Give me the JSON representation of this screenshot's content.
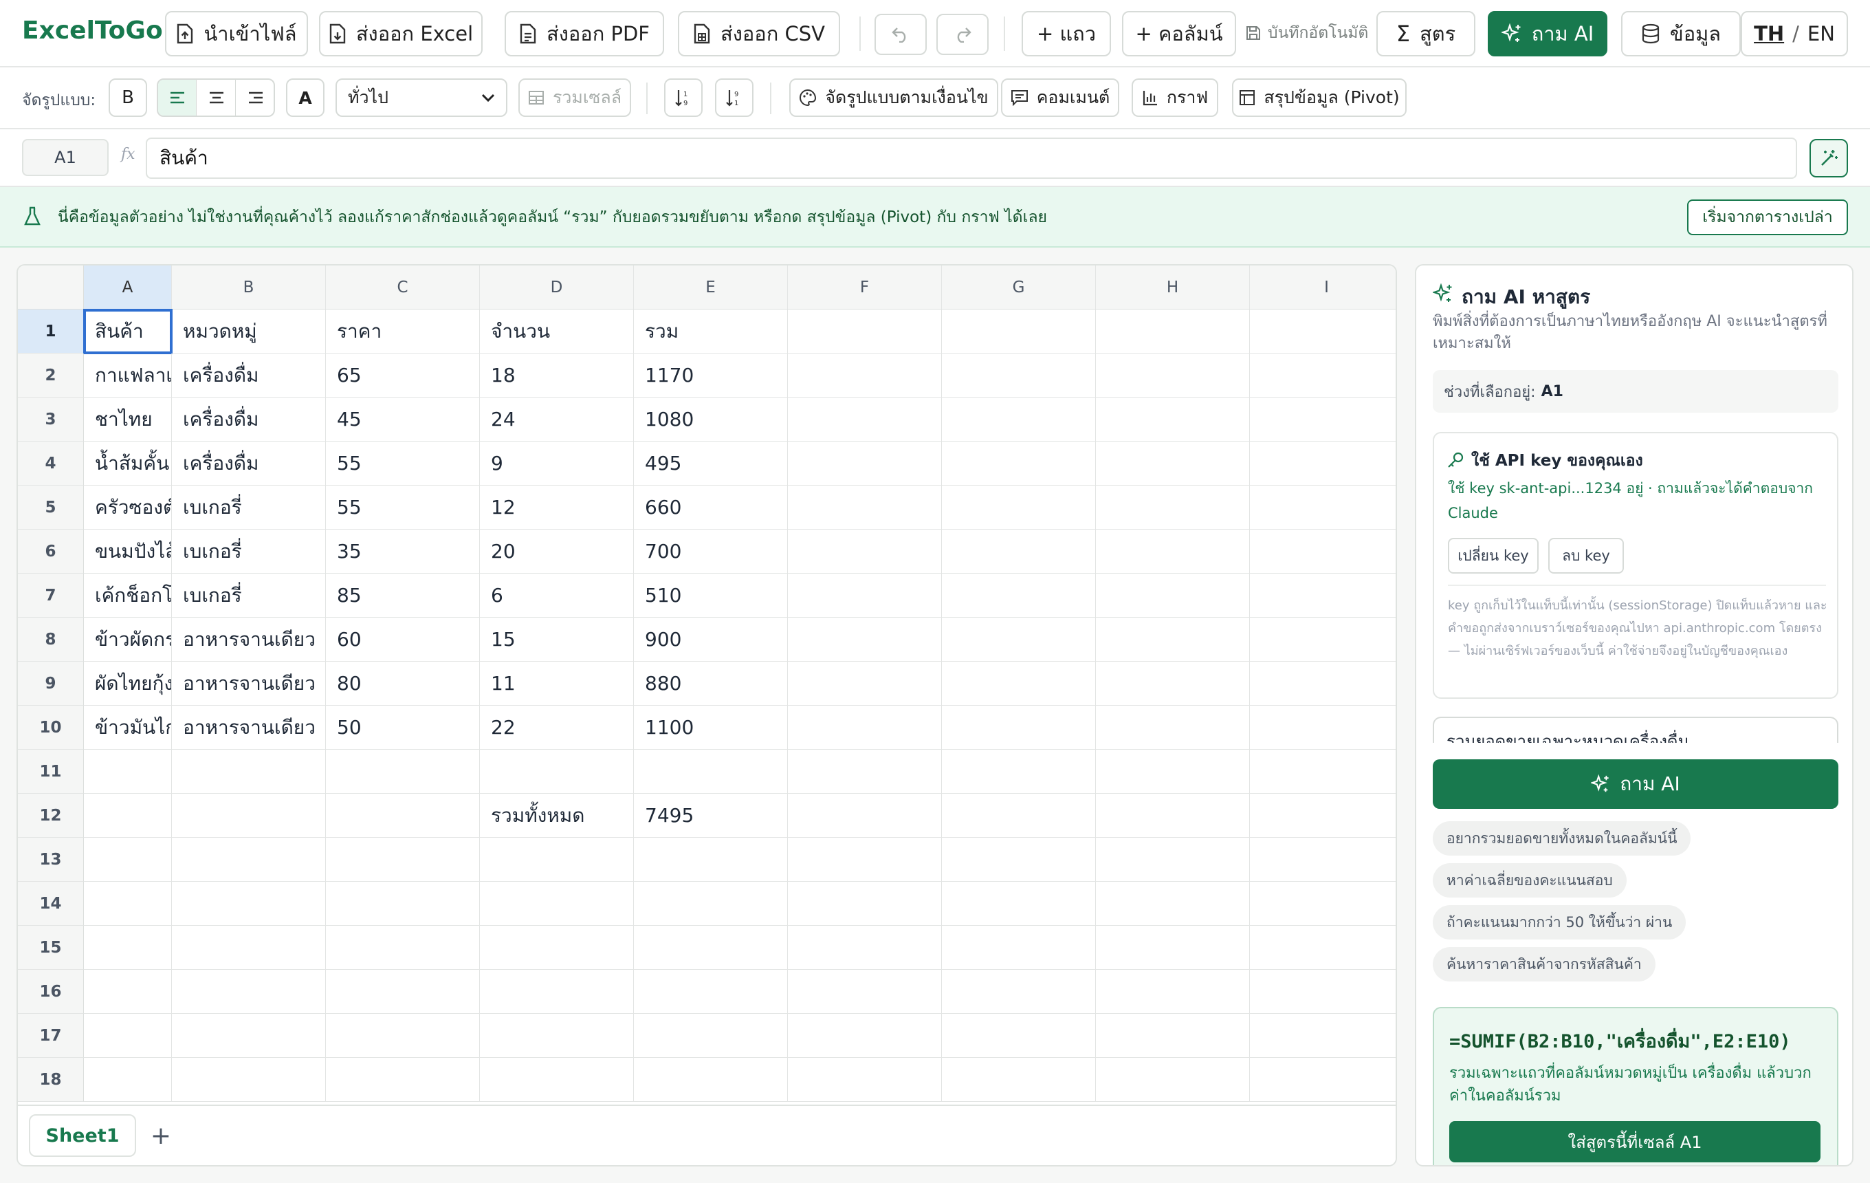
{
  "app": {
    "brand": "ExcelToGo"
  },
  "toolbar": {
    "import": "นำเข้าไฟล์",
    "export_excel": "ส่งออก Excel",
    "export_pdf": "ส่งออก PDF",
    "export_csv": "ส่งออก CSV",
    "add_row": "+ แถว",
    "add_col": "+ คอลัมน์",
    "autosave": "บันทึกอัตโนมัติ",
    "formula": "สูตร",
    "ask_ai": "ถาม AI",
    "data": "ข้อมูล",
    "lang_th": "TH",
    "lang_sep": "/",
    "lang_en": "EN"
  },
  "format_bar": {
    "label": "จัดรูปแบบ:",
    "bold": "B",
    "font_color": "A",
    "number_format": "ทั่วไป",
    "merge": "รวมเซลล์",
    "cond_format": "จัดรูปแบบตามเงื่อนไข",
    "comment": "คอมเมนต์",
    "chart": "กราฟ",
    "pivot": "สรุปข้อมูล (Pivot)"
  },
  "formula_bar": {
    "cell_ref": "A1",
    "fx": "fx",
    "value": "สินค้า"
  },
  "banner": {
    "text": "นี่คือข้อมูลตัวอย่าง ไม่ใช่งานที่คุณค้างไว้ ลองแก้ราคาสักช่องแล้วดูคอลัมน์ “รวม” กับยอดรวมขยับตาม หรือกด สรุปข้อมูล (Pivot) กับ กราฟ ได้เลย",
    "button": "เริ่มจากตารางเปล่า"
  },
  "grid": {
    "columns": [
      "A",
      "B",
      "C",
      "D",
      "E",
      "F",
      "G",
      "H",
      "I"
    ],
    "row_numbers": [
      "1",
      "2",
      "3",
      "4",
      "5",
      "6",
      "7",
      "8",
      "9",
      "10",
      "11",
      "12",
      "13",
      "14",
      "15",
      "16",
      "17",
      "18"
    ],
    "rows": [
      [
        "สินค้า",
        "หมวดหมู่",
        "ราคา",
        "จำนวน",
        "รวม"
      ],
      [
        "กาแฟลาเต้",
        "เครื่องดื่ม",
        "65",
        "18",
        "1170"
      ],
      [
        "ชาไทย",
        "เครื่องดื่ม",
        "45",
        "24",
        "1080"
      ],
      [
        "น้ำส้มคั้น",
        "เครื่องดื่ม",
        "55",
        "9",
        "495"
      ],
      [
        "ครัวซองต์",
        "เบเกอรี่",
        "55",
        "12",
        "660"
      ],
      [
        "ขนมปังไส้ทะลัก",
        "เบเกอรี่",
        "35",
        "20",
        "700"
      ],
      [
        "เค้กช็อกโกแลต",
        "เบเกอรี่",
        "85",
        "6",
        "510"
      ],
      [
        "ข้าวผัดกระเพรา",
        "อาหารจานเดียว",
        "60",
        "15",
        "900"
      ],
      [
        "ผัดไทยกุ้งสด",
        "อาหารจานเดียว",
        "80",
        "11",
        "880"
      ],
      [
        "ข้าวมันไก่",
        "อาหารจานเดียว",
        "50",
        "22",
        "1100"
      ],
      [
        "",
        "",
        "",
        "",
        ""
      ],
      [
        "",
        "",
        "",
        "รวมทั้งหมด",
        "7495"
      ]
    ],
    "active_cell": "A1"
  },
  "sheet_tabs": {
    "active": "Sheet1",
    "add": "+"
  },
  "ai_panel": {
    "title": "ถาม AI หาสูตร",
    "subtitle": "พิมพ์สิ่งที่ต้องการเป็นภาษาไทยหรืออังกฤษ AI จะแนะนำสูตรที่เหมาะสมให้",
    "selection_label": "ช่วงที่เลือกอยู่:",
    "selection_value": "A1",
    "api": {
      "title": "ใช้ API key ของคุณเอง",
      "status": "ใช้ key sk-ant-api...1234 อยู่ · ถามแล้วจะได้คำตอบจาก Claude",
      "change_btn": "เปลี่ยน key",
      "delete_btn": "ลบ key",
      "note": "key ถูกเก็บไว้ในแท็บนี้เท่านั้น (sessionStorage) ปิดแท็บแล้วหาย และคำขอถูกส่งจากเบราว์เซอร์ของคุณไปหา api.anthropic.com โดยตรง — ไม่ผ่านเซิร์ฟเวอร์ของเว็บนี้ ค่าใช้จ่ายจึงอยู่ในบัญชีของคุณเอง"
    },
    "prompt_value": "รวมยอดขายเฉพาะหมวดเครื่องดื่ม",
    "ask_button": "ถาม AI",
    "suggestions": [
      "อยากรวมยอดขายทั้งหมดในคอลัมน์นี้",
      "หาค่าเฉลี่ยของคะแนนสอบ",
      "ถ้าคะแนนมากกว่า 50 ให้ขึ้นว่า ผ่าน",
      "ค้นหาราคาสินค้าจากรหัสสินค้า"
    ],
    "result": {
      "formula": "=SUMIF(B2:B10,\"เครื่องดื่ม\",E2:E10)",
      "explanation": "รวมเฉพาะแถวที่คอลัมน์หมวดหมู่เป็น เครื่องดื่ม แล้วบวกค่าในคอลัมน์รวม",
      "insert_button": "ใส่สูตรนี้ที่เซลล์ A1"
    }
  },
  "colors": {
    "brand": "#18794e",
    "selection": "#2f6fd1",
    "banner_bg": "#e9f8f0"
  }
}
